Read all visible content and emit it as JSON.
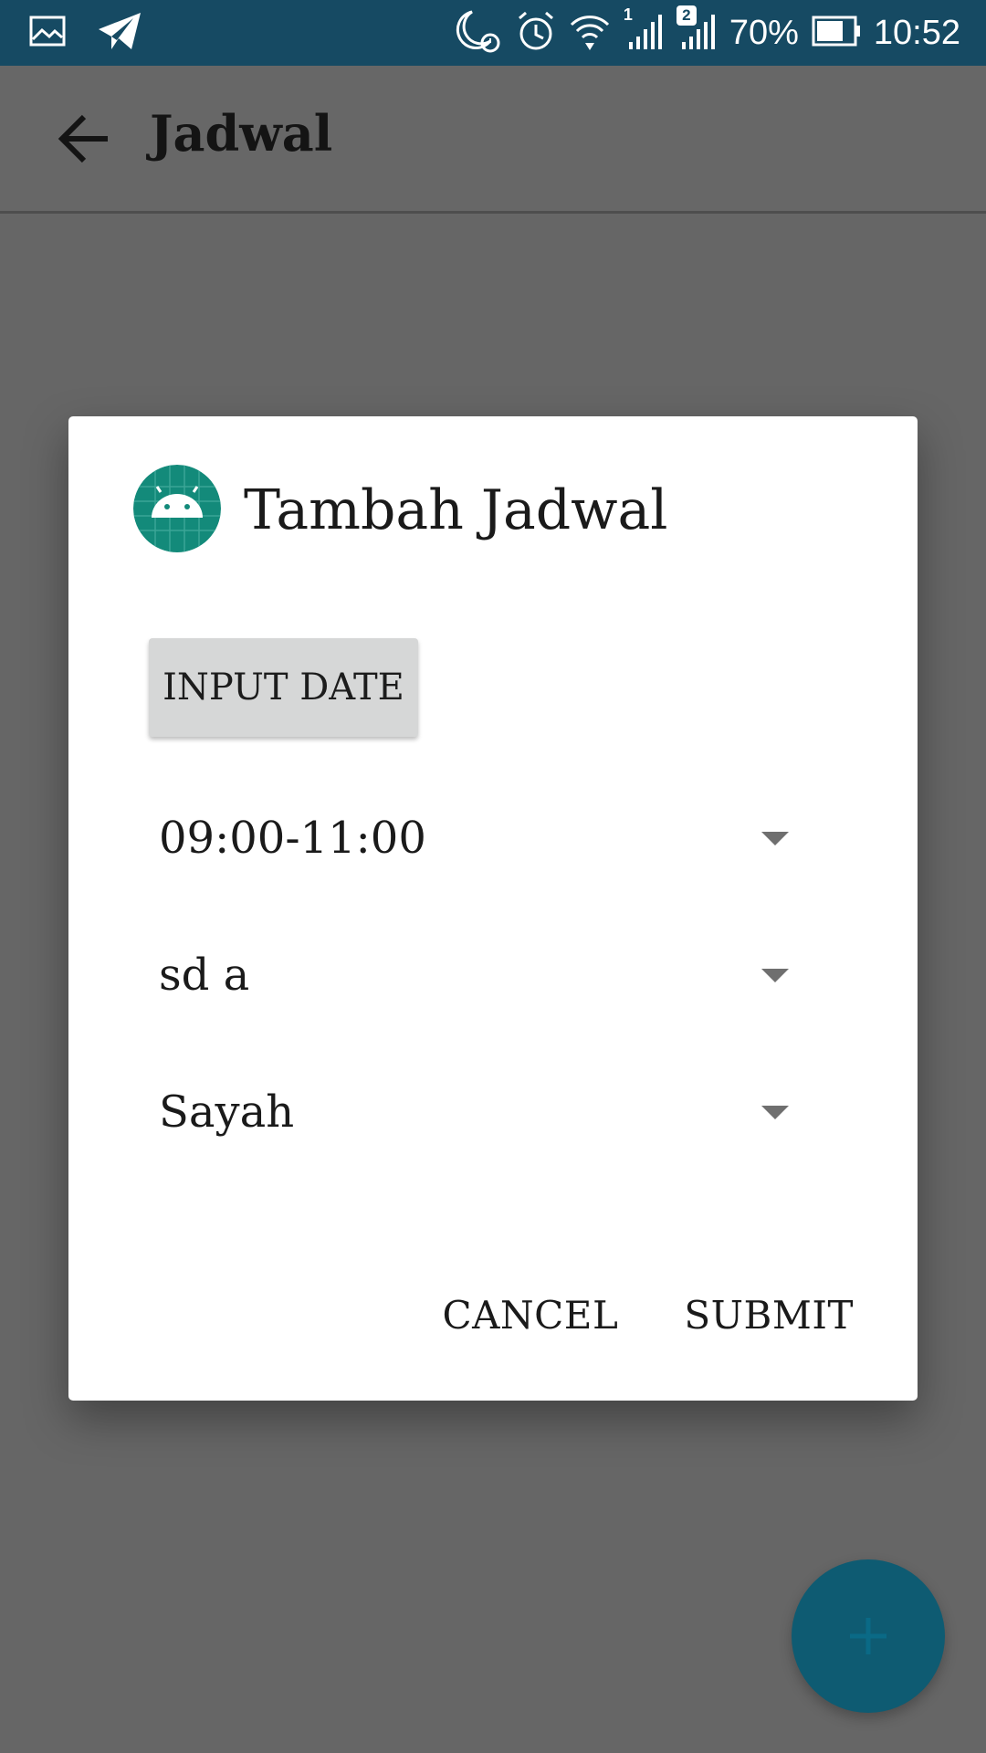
{
  "status_bar": {
    "battery_percent": "70%",
    "time": "10:52",
    "sim1_label": "1",
    "sim2_label": "2",
    "icons": [
      "image-icon",
      "telegram-icon",
      "do-not-disturb-icon",
      "alarm-icon",
      "wifi-icon",
      "signal-icon",
      "signal-icon",
      "battery-icon"
    ]
  },
  "app_bar": {
    "title": "Jadwal",
    "back_icon": "arrow-back-icon"
  },
  "dialog": {
    "title": "Tambah Jadwal",
    "icon": "android-icon",
    "input_date_label": "INPUT DATE",
    "spinners": [
      {
        "value": "09:00-11:00"
      },
      {
        "value": "sd a"
      },
      {
        "value": "Sayah"
      }
    ],
    "cancel_label": "CANCEL",
    "submit_label": "SUBMIT"
  },
  "fab": {
    "icon": "plus-icon"
  },
  "colors": {
    "status_bar": "#164a63",
    "scrim": "#666666",
    "fab": "#0e5b72",
    "android_icon_bg": "#138a7a"
  }
}
